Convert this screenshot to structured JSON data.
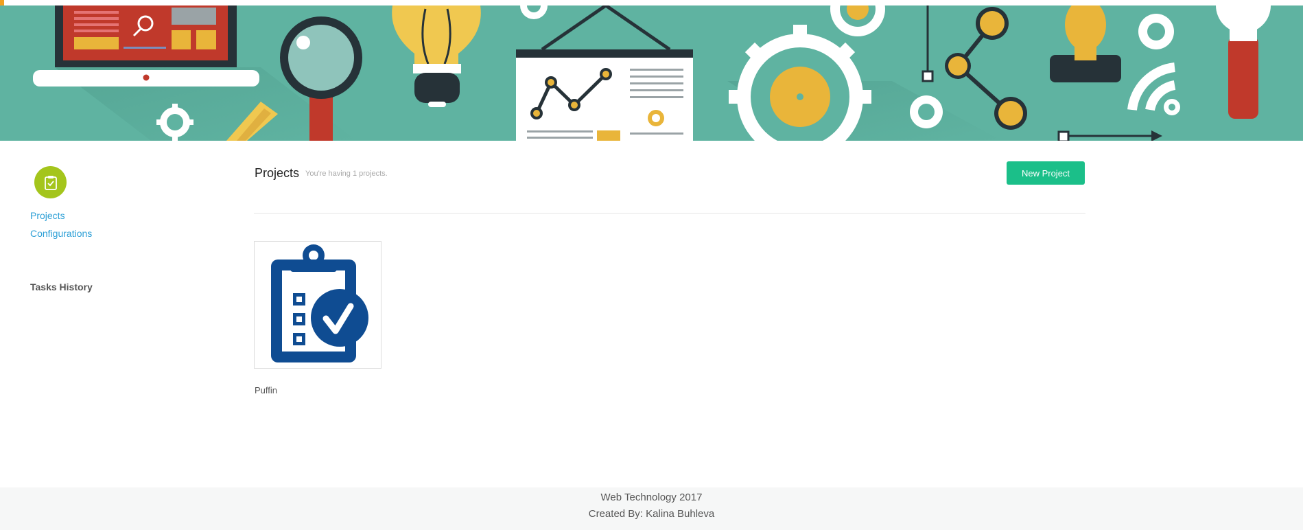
{
  "sidebar": {
    "icon": "clipboard-check-icon",
    "links": [
      "Projects",
      "Configurations"
    ],
    "heading": "Tasks History"
  },
  "main": {
    "title": "Projects",
    "subtitle": "You're having 1 projects.",
    "new_button": "New Project",
    "projects": [
      {
        "name": "Puffin",
        "icon": "clipboard-checklist-icon"
      }
    ]
  },
  "footer": {
    "line1": "Web Technology 2017",
    "line2": "Created By: Kalina Buhleva"
  },
  "colors": {
    "banner_bg": "#5fb3a1",
    "accent_green": "#1bbf89",
    "link_blue": "#2c9fd6",
    "sidebar_icon_bg": "#a4c51c",
    "project_icon": "#0f4c92"
  }
}
